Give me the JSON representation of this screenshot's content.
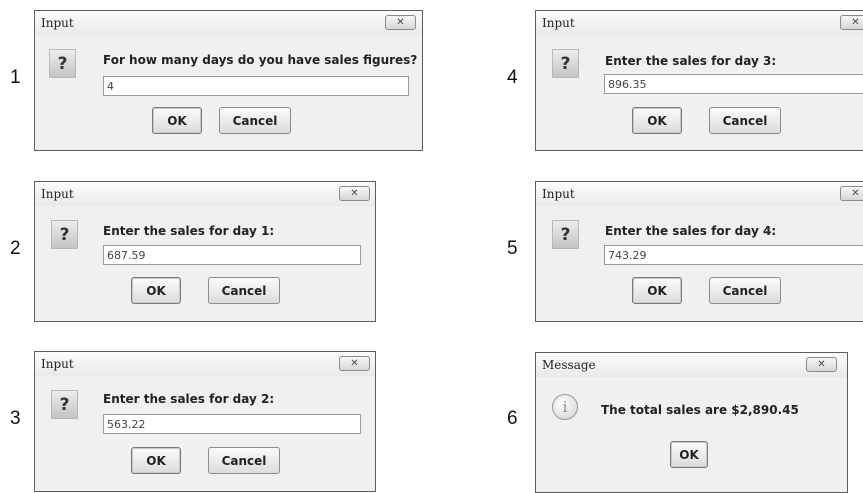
{
  "steps": [
    "1",
    "2",
    "3",
    "4",
    "5",
    "6"
  ],
  "dialogs": [
    {
      "title": "Input",
      "close_label": "✕",
      "icon": "question-icon",
      "prompt": "For how many days do you have sales figures?",
      "value": "4",
      "ok_label": "OK",
      "cancel_label": "Cancel"
    },
    {
      "title": "Input",
      "close_label": "✕",
      "icon": "question-icon",
      "prompt": "Enter the sales for day 1:",
      "value": "687.59",
      "ok_label": "OK",
      "cancel_label": "Cancel"
    },
    {
      "title": "Input",
      "close_label": "✕",
      "icon": "question-icon",
      "prompt": "Enter the sales for day 2:",
      "value": "563.22",
      "ok_label": "OK",
      "cancel_label": "Cancel"
    },
    {
      "title": "Input",
      "close_label": "✕",
      "icon": "question-icon",
      "prompt": "Enter the sales for day 3:",
      "value": "896.35",
      "ok_label": "OK",
      "cancel_label": "Cancel"
    },
    {
      "title": "Input",
      "close_label": "✕",
      "icon": "question-icon",
      "prompt": "Enter the sales for day 4:",
      "value": "743.29",
      "ok_label": "OK",
      "cancel_label": "Cancel"
    },
    {
      "title": "Message",
      "close_label": "✕",
      "icon": "info-icon",
      "message": "The total sales are $2,890.45",
      "ok_label": "OK"
    }
  ]
}
